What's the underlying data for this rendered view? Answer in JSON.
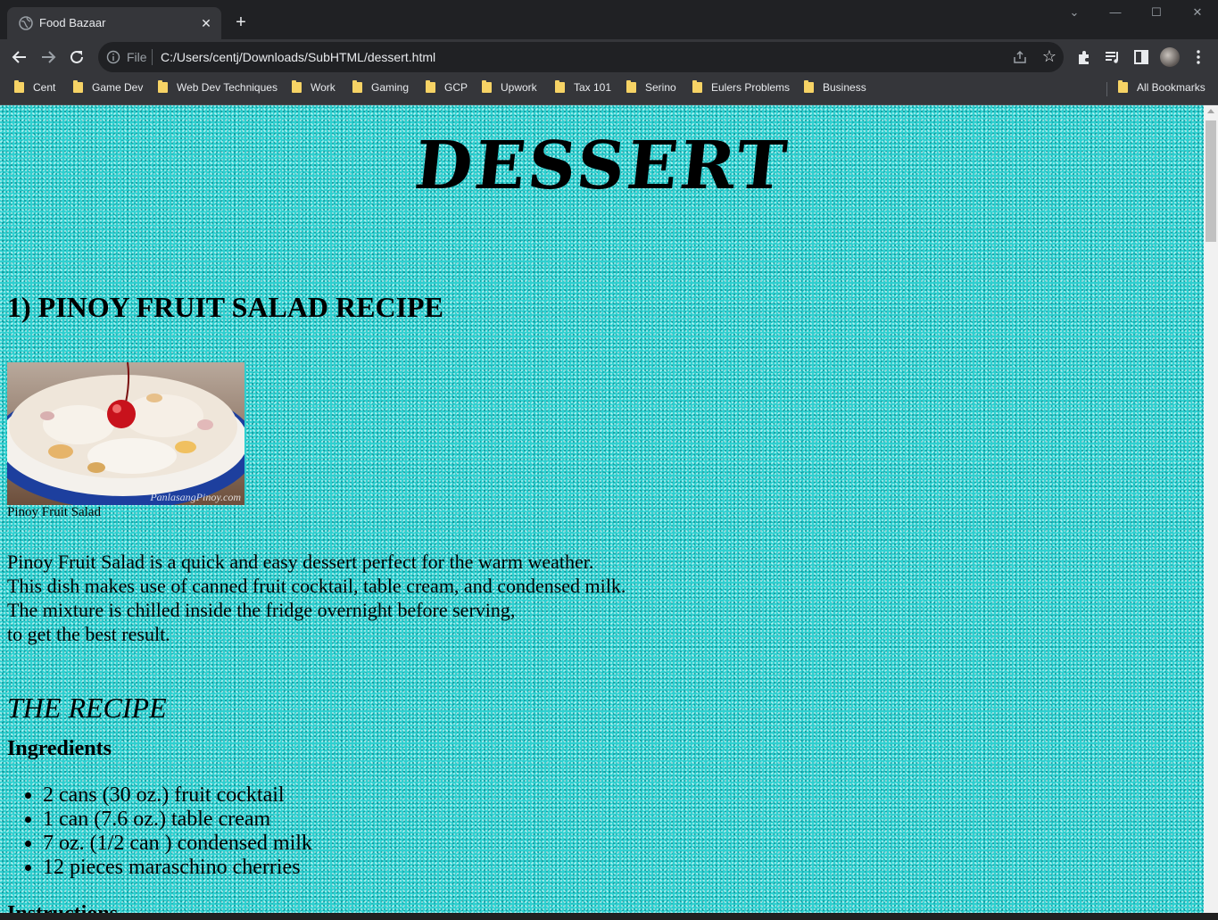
{
  "browser": {
    "tab_title": "Food Bazaar",
    "tab_close": "✕",
    "new_tab": "+",
    "window_controls": {
      "chevron": "⌄",
      "minimize": "—",
      "maximize": "☐",
      "close": "✕"
    },
    "url_scheme": "File",
    "url": "C:/Users/centj/Downloads/SubHTML/dessert.html",
    "bookmarks": [
      "Cent",
      "Game Dev",
      "Web Dev Techniques",
      "Work",
      "Gaming",
      "GCP",
      "Upwork",
      "Tax 101",
      "Serino",
      "Eulers Problems",
      "Business"
    ],
    "all_bookmarks": "All Bookmarks",
    "colors": {
      "frame": "#202124",
      "toolbar": "#35363a",
      "folder": "#f6d365"
    }
  },
  "page": {
    "heading": "DESSERT",
    "recipe_title": "1) PINOY FRUIT SALAD RECIPE",
    "image_watermark": "PanlasangPinoy.com",
    "image_caption": "Pinoy Fruit Salad",
    "intro_lines": [
      "Pinoy Fruit Salad is a quick and easy dessert perfect for the warm weather.",
      "This dish makes use of canned fruit cocktail, table cream, and condensed milk.",
      "The mixture is chilled inside the fridge overnight before serving,",
      "to get the best result."
    ],
    "recipe_subheading": "THE RECIPE",
    "ingredients_heading": "Ingredients",
    "ingredients": [
      "2 cans (30 oz.) fruit cocktail",
      "1 can (7.6 oz.) table cream",
      "7 oz. (1/2 can ) condensed milk",
      "12 pieces maraschino cherries"
    ],
    "instructions_heading": "Instructions",
    "background_color": "#2fd0d0"
  }
}
